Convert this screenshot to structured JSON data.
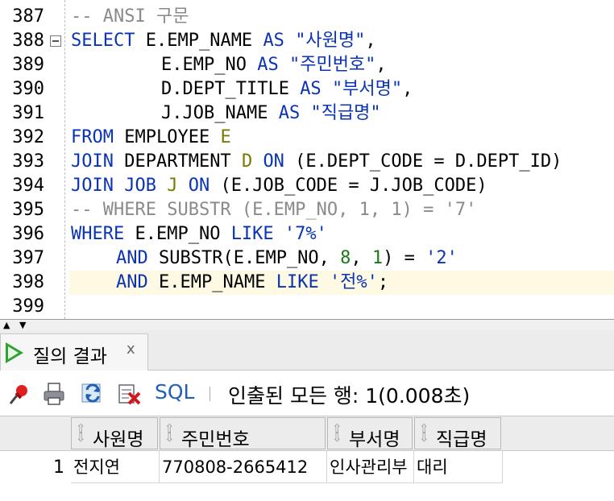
{
  "editor": {
    "line_numbers": [
      "387",
      "388",
      "389",
      "390",
      "391",
      "392",
      "393",
      "394",
      "395",
      "396",
      "397",
      "398",
      "399"
    ],
    "l387": {
      "comment": "-- ANSI 구문"
    },
    "l388": {
      "kw": "SELECT",
      "col": " E.EMP_NAME ",
      "as": "AS",
      "sp": " ",
      "str": "\"사원명\"",
      "tail": ","
    },
    "l389": {
      "col": "E.EMP_NO ",
      "as": "AS",
      "sp": " ",
      "str": "\"주민번호\"",
      "tail": ","
    },
    "l390": {
      "col": "D.DEPT_TITLE ",
      "as": "AS",
      "sp": " ",
      "str": "\"부서명\"",
      "tail": ","
    },
    "l391": {
      "col": "J.JOB_NAME ",
      "as": "AS",
      "sp": " ",
      "str": "\"직급명\""
    },
    "l392": {
      "kw": "FROM",
      "tbl": " EMPLOYEE ",
      "alias": "E"
    },
    "l393": {
      "kw": "JOIN",
      "tbl": " DEPARTMENT ",
      "alias": "D",
      "sp": " ",
      "on": "ON",
      "cond": " (E.DEPT_CODE = D.DEPT_ID)"
    },
    "l394": {
      "kw": "JOIN",
      "sp1": " ",
      "tbl": "JOB",
      "sp2": " ",
      "alias": "J",
      "sp3": " ",
      "on": "ON",
      "cond": " (E.JOB_CODE = J.JOB_CODE)"
    },
    "l395": {
      "comment": "-- WHERE SUBSTR (E.EMP_NO, 1, 1) = '7'"
    },
    "l396": {
      "kw": "WHERE",
      "col": " E.EMP_NO ",
      "like": "LIKE",
      "sp": " ",
      "str": "'7%'"
    },
    "l397": {
      "and": "AND",
      "fn": " SUBSTR(E.EMP_NO, ",
      "n1": "8",
      "c": ", ",
      "n2": "1",
      "close": ") = ",
      "str": "'2'"
    },
    "l398": {
      "and": "AND",
      "col": " E.EMP_NAME ",
      "like": "LIKE",
      "sp": " ",
      "str": "'전%'",
      "tail": ";"
    }
  },
  "results_tab": {
    "label": "질의 결과",
    "close": "x"
  },
  "toolbar": {
    "sql_label": "SQL",
    "status": "인출된 모든 행: 1(0.008초)"
  },
  "grid": {
    "columns": [
      "사원명",
      "주민번호",
      "부서명",
      "직급명"
    ],
    "rows": [
      {
        "num": "1",
        "cells": [
          "전지연",
          "770808-2665412",
          "인사관리부",
          "대리"
        ]
      }
    ]
  },
  "colors": {
    "keyword": "#0a34b5",
    "comment": "#8a8a8a",
    "number": "#1a7a1a",
    "alias": "#7a7a00",
    "current_line": "#fdf9e3"
  }
}
